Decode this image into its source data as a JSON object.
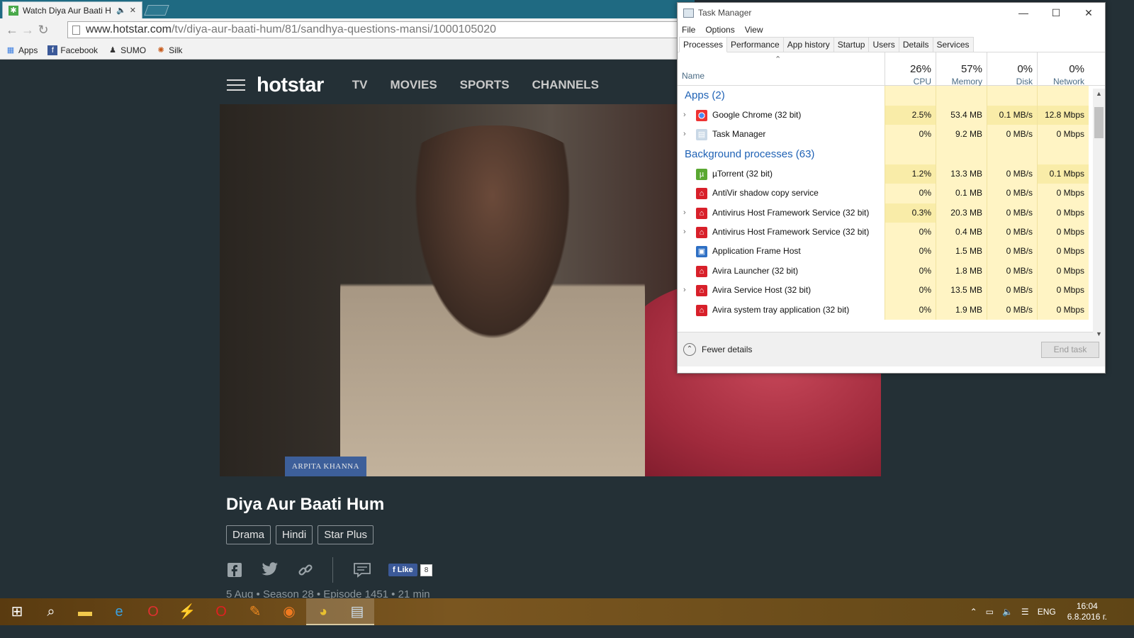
{
  "browser": {
    "tab_title": "Watch Diya Aur Baati H",
    "url_host": "www.hotstar.com",
    "url_path": "/tv/diya-aur-baati-hum/81/sandhya-questions-mansi/1000105020",
    "bookmarks": [
      "Apps",
      "Facebook",
      "SUMO",
      "Silk"
    ]
  },
  "hotstar": {
    "brand": "hotstar",
    "nav": [
      "TV",
      "MOVIES",
      "SPORTS",
      "CHANNELS"
    ],
    "video_nametag": "ARPITA KHANNA",
    "show_title": "Diya Aur Baati Hum",
    "tags": [
      "Drama",
      "Hindi",
      "Star Plus"
    ],
    "like_label": "Like",
    "like_count": "8",
    "meta": "5 Aug • Season 28 • Episode 1451 • 21 min"
  },
  "taskmanager": {
    "title": "Task Manager",
    "menu": [
      "File",
      "Options",
      "View"
    ],
    "tabs": [
      "Processes",
      "Performance",
      "App history",
      "Startup",
      "Users",
      "Details",
      "Services"
    ],
    "columns": {
      "name": "Name",
      "cpu": {
        "pct": "26%",
        "label": "CPU"
      },
      "memory": {
        "pct": "57%",
        "label": "Memory"
      },
      "disk": {
        "pct": "0%",
        "label": "Disk"
      },
      "network": {
        "pct": "0%",
        "label": "Network"
      }
    },
    "groups": {
      "apps": "Apps (2)",
      "background": "Background processes (63)"
    },
    "apps": [
      {
        "name": "Google Chrome (32 bit)",
        "cpu": "2.5%",
        "memory": "53.4 MB",
        "disk": "0.1 MB/s",
        "network": "12.8 Mbps",
        "expandable": true,
        "icon": "chrome-icon"
      },
      {
        "name": "Task Manager",
        "cpu": "0%",
        "memory": "9.2 MB",
        "disk": "0 MB/s",
        "network": "0 Mbps",
        "expandable": true,
        "icon": "taskmanager-icon"
      }
    ],
    "background": [
      {
        "name": "µTorrent (32 bit)",
        "cpu": "1.2%",
        "memory": "13.3 MB",
        "disk": "0 MB/s",
        "network": "0.1 Mbps",
        "expandable": false,
        "icon": "utorrent-icon"
      },
      {
        "name": "AntiVir shadow copy service",
        "cpu": "0%",
        "memory": "0.1 MB",
        "disk": "0 MB/s",
        "network": "0 Mbps",
        "expandable": false,
        "icon": "avira-icon"
      },
      {
        "name": "Antivirus Host Framework Service (32 bit)",
        "cpu": "0.3%",
        "memory": "20.3 MB",
        "disk": "0 MB/s",
        "network": "0 Mbps",
        "expandable": true,
        "icon": "avira-icon"
      },
      {
        "name": "Antivirus Host Framework Service (32 bit)",
        "cpu": "0%",
        "memory": "0.4 MB",
        "disk": "0 MB/s",
        "network": "0 Mbps",
        "expandable": true,
        "icon": "avira-icon"
      },
      {
        "name": "Application Frame Host",
        "cpu": "0%",
        "memory": "1.5 MB",
        "disk": "0 MB/s",
        "network": "0 Mbps",
        "expandable": false,
        "icon": "appframe-icon"
      },
      {
        "name": "Avira Launcher (32 bit)",
        "cpu": "0%",
        "memory": "1.8 MB",
        "disk": "0 MB/s",
        "network": "0 Mbps",
        "expandable": false,
        "icon": "avira-icon"
      },
      {
        "name": "Avira Service Host (32 bit)",
        "cpu": "0%",
        "memory": "13.5 MB",
        "disk": "0 MB/s",
        "network": "0 Mbps",
        "expandable": true,
        "icon": "avira-icon"
      },
      {
        "name": "Avira system tray application (32 bit)",
        "cpu": "0%",
        "memory": "1.9 MB",
        "disk": "0 MB/s",
        "network": "0 Mbps",
        "expandable": false,
        "icon": "avira-icon"
      }
    ],
    "fewer_details": "Fewer details",
    "end_task": "End task"
  },
  "taskbar": {
    "language": "ENG",
    "time": "16:04",
    "date": "6.8.2016 г."
  },
  "colors": {
    "hotstar_bg": "#243036",
    "chrome_tabstrip": "#1f6a82",
    "tm_heat": "#fff4c4",
    "tm_group": "#1f62b5",
    "taskbar": "#6b4a18"
  }
}
